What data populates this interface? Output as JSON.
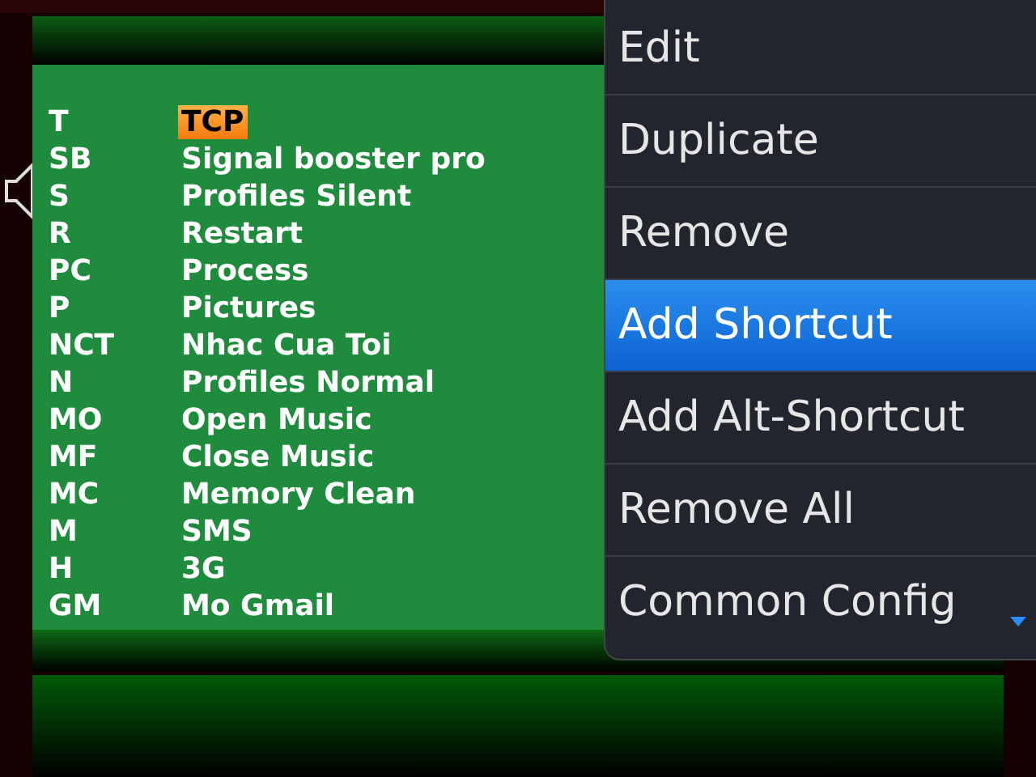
{
  "shortcuts": [
    {
      "key": "T",
      "name": "TCP",
      "selected": true
    },
    {
      "key": "SB",
      "name": "Signal booster pro",
      "selected": false
    },
    {
      "key": "S",
      "name": "Profiles Silent",
      "selected": false
    },
    {
      "key": "R",
      "name": "Restart",
      "selected": false
    },
    {
      "key": "PC",
      "name": "Process",
      "selected": false
    },
    {
      "key": "P",
      "name": "Pictures",
      "selected": false
    },
    {
      "key": "NCT",
      "name": "Nhac Cua Toi",
      "selected": false
    },
    {
      "key": "N",
      "name": "Profiles Normal",
      "selected": false
    },
    {
      "key": "MO",
      "name": "Open Music",
      "selected": false
    },
    {
      "key": "MF",
      "name": "Close Music",
      "selected": false
    },
    {
      "key": "MC",
      "name": "Memory Clean",
      "selected": false
    },
    {
      "key": "M",
      "name": "SMS",
      "selected": false
    },
    {
      "key": "H",
      "name": "3G",
      "selected": false
    },
    {
      "key": "GM",
      "name": "Mo Gmail",
      "selected": false
    }
  ],
  "menu": {
    "more_below": true,
    "items": [
      {
        "label": "Edit",
        "selected": false
      },
      {
        "label": "Duplicate",
        "selected": false
      },
      {
        "label": "Remove",
        "selected": false
      },
      {
        "label": "Add Shortcut",
        "selected": true
      },
      {
        "label": "Add Alt-Shortcut",
        "selected": false
      },
      {
        "label": "Remove All",
        "selected": false
      },
      {
        "label": "Common Config",
        "selected": false
      }
    ]
  }
}
